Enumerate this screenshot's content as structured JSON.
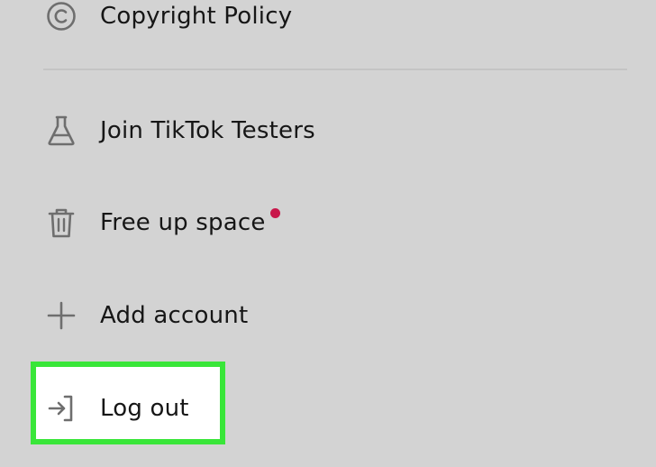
{
  "menu": {
    "items": [
      {
        "label": "Copyright Policy",
        "icon": "copyright-icon"
      },
      {
        "label": "Join TikTok Testers",
        "icon": "flask-icon"
      },
      {
        "label": "Free up space",
        "icon": "trash-icon",
        "has_dot": true
      },
      {
        "label": "Add account",
        "icon": "plus-icon"
      },
      {
        "label": "Log out",
        "icon": "logout-icon",
        "highlighted": true
      }
    ]
  },
  "colors": {
    "background": "#d3d3d3",
    "text": "#161616",
    "icon": "#6e6e6e",
    "notification_dot": "#c8174a",
    "highlight_border": "#39e639",
    "highlight_fill": "#ffffff",
    "divider": "#c4c4c4"
  }
}
